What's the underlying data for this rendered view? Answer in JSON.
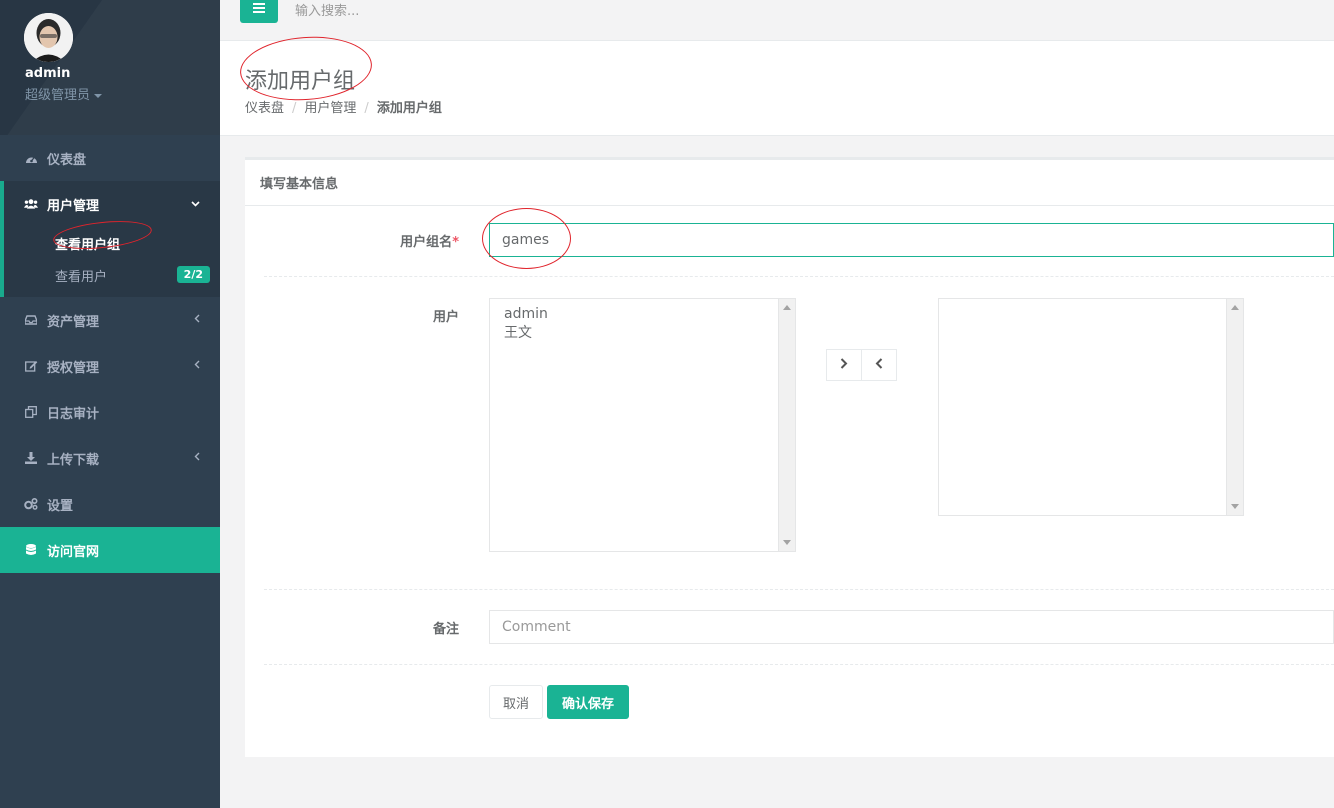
{
  "profile": {
    "name": "admin",
    "role": "超级管理员"
  },
  "sidebar": {
    "items": [
      {
        "label": "仪表盘",
        "icon": "dashboard-icon"
      },
      {
        "label": "用户管理",
        "icon": "users-icon"
      },
      {
        "label": "资产管理",
        "icon": "inbox-icon"
      },
      {
        "label": "授权管理",
        "icon": "edit-icon"
      },
      {
        "label": "日志审计",
        "icon": "copy-icon"
      },
      {
        "label": "上传下载",
        "icon": "download-icon"
      },
      {
        "label": "设置",
        "icon": "gears-icon"
      },
      {
        "label": "访问官网",
        "icon": "database-icon"
      }
    ],
    "sub_items": [
      {
        "label": "查看用户组"
      },
      {
        "label": "查看用户",
        "badge": "2/2"
      }
    ]
  },
  "topbar": {
    "search_placeholder": "输入搜索..."
  },
  "heading": {
    "title": "添加用户组",
    "breadcrumb": [
      "仪表盘",
      "用户管理",
      "添加用户组"
    ]
  },
  "panel": {
    "title": "填写基本信息"
  },
  "form": {
    "group_name_label": "用户组名",
    "group_name_required": "*",
    "group_name_value": "games",
    "users_label": "用户",
    "available_users": [
      "admin",
      "王文"
    ],
    "selected_users": [],
    "comment_label": "备注",
    "comment_placeholder": "Comment",
    "cancel_label": "取消",
    "save_label": "确认保存"
  },
  "colors": {
    "accent": "#1ab394",
    "sidebar_bg": "#2f4050",
    "annotation": "#e0242c"
  }
}
